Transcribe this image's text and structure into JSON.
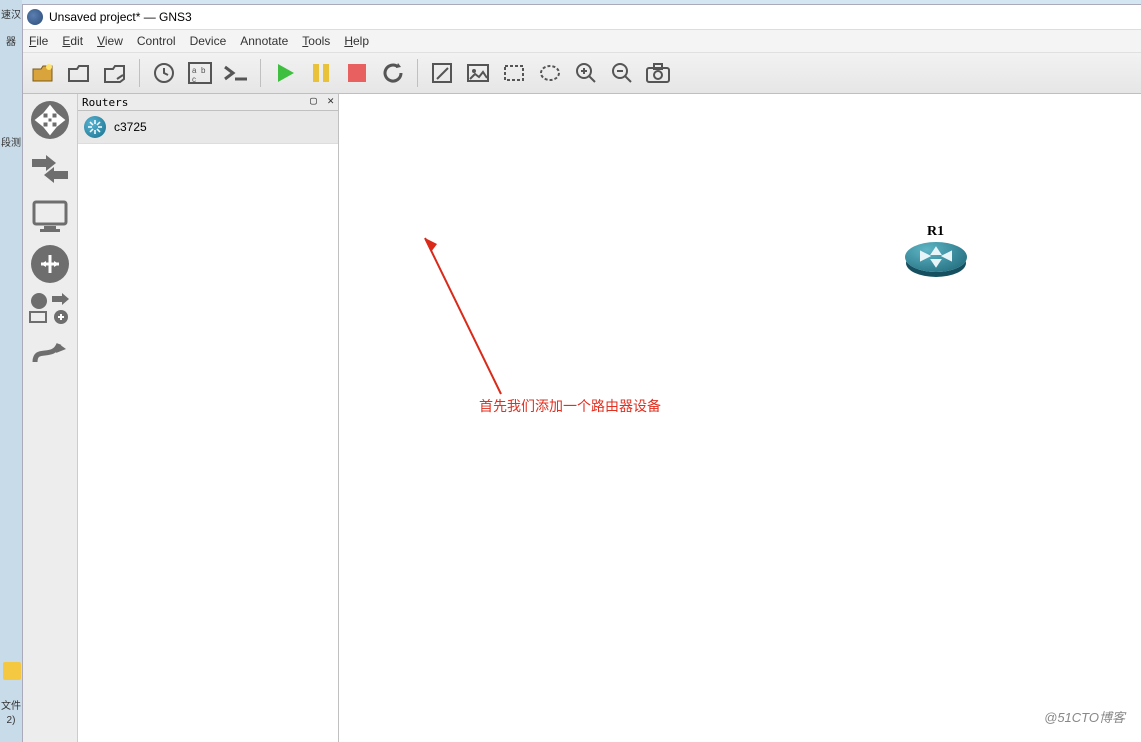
{
  "desktop": {
    "left_strip_top": "速汉",
    "left_strip_mid": "器",
    "left_strip_seg": "段测",
    "file_label": "文件",
    "file_num": "2)"
  },
  "window": {
    "title": "Unsaved project* — GNS3"
  },
  "menu": {
    "file": "File",
    "edit": "Edit",
    "view": "View",
    "control": "Control",
    "device": "Device",
    "annotate": "Annotate",
    "tools": "Tools",
    "help": "Help"
  },
  "toolbar_icons": {
    "new": "new-project-icon",
    "open": "open-icon",
    "save": "save-icon",
    "recent": "recent-icon",
    "abc": "abc-icon",
    "console": "console-icon",
    "play": "play-icon",
    "pause": "pause-icon",
    "stop": "stop-icon",
    "reload": "reload-icon",
    "note": "note-icon",
    "image": "image-icon",
    "rect": "rect-icon",
    "ellipse": "ellipse-icon",
    "zoomin": "zoom-in-icon",
    "zoomout": "zoom-out-icon",
    "screenshot": "screenshot-icon"
  },
  "dock": {
    "routers": "routers-dock",
    "switches": "switches-dock",
    "end": "end-devices-dock",
    "security": "security-dock",
    "all": "all-devices-dock",
    "link": "add-link-dock"
  },
  "panel": {
    "title": "Routers",
    "items": [
      {
        "label": "c3725"
      }
    ],
    "undock": "⬜",
    "close": "✕"
  },
  "canvas": {
    "router_label": "R1"
  },
  "annotation": "首先我们添加一个路由器设备",
  "watermark": "@51CTO博客"
}
